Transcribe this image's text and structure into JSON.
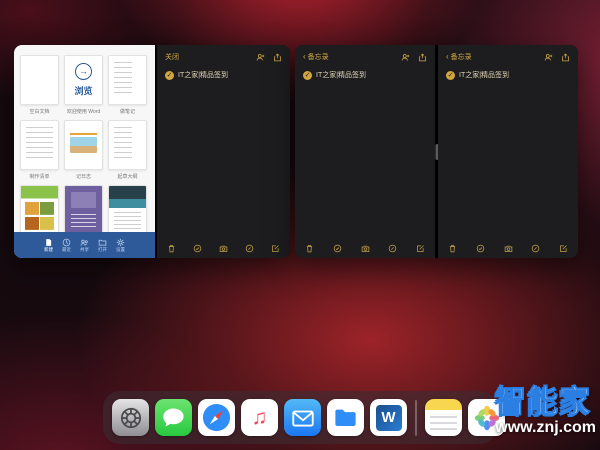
{
  "colors": {
    "word_accent": "#2b579a",
    "notes_bg": "#1d1d1f",
    "notes_accent": "#d2a63f",
    "wallpaper_red": "#c02330",
    "watermark_blue": "#2b7fe3"
  },
  "expose": {
    "window1": {
      "word": {
        "templates_row1": [
          {
            "label": "空白文档"
          },
          {
            "label": "欢迎使用 Word",
            "card_text": "浏览",
            "card_icon_glyph": "→"
          },
          {
            "label": "做笔记"
          }
        ],
        "templates_row2": [
          {
            "label": "制作清单"
          },
          {
            "label": "记日志"
          },
          {
            "label": "起草大纲"
          }
        ],
        "tabbar": [
          {
            "label": "新建"
          },
          {
            "label": "最近"
          },
          {
            "label": "共享"
          },
          {
            "label": "打开"
          },
          {
            "label": "设置"
          }
        ]
      },
      "notes": {
        "header_left": "关闭",
        "note_title": "IT之家|精品签到",
        "check_glyph": "✓"
      }
    },
    "window2": {
      "left_notes": {
        "back_chevron": "‹",
        "back_label": "备忘录",
        "note_title": "IT之家|精品签到",
        "check_glyph": "✓"
      },
      "right_notes": {
        "back_chevron": "‹",
        "back_label": "备忘录",
        "note_title": "IT之家|精品签到",
        "check_glyph": "✓"
      }
    }
  },
  "dock": {
    "apps": [
      "settings",
      "messages",
      "safari",
      "music",
      "mail",
      "files",
      "word",
      "notes",
      "photos"
    ],
    "music_glyph": "♫",
    "word_letter": "W"
  },
  "watermark": {
    "title": "智能家",
    "url": "www.znj.com"
  }
}
